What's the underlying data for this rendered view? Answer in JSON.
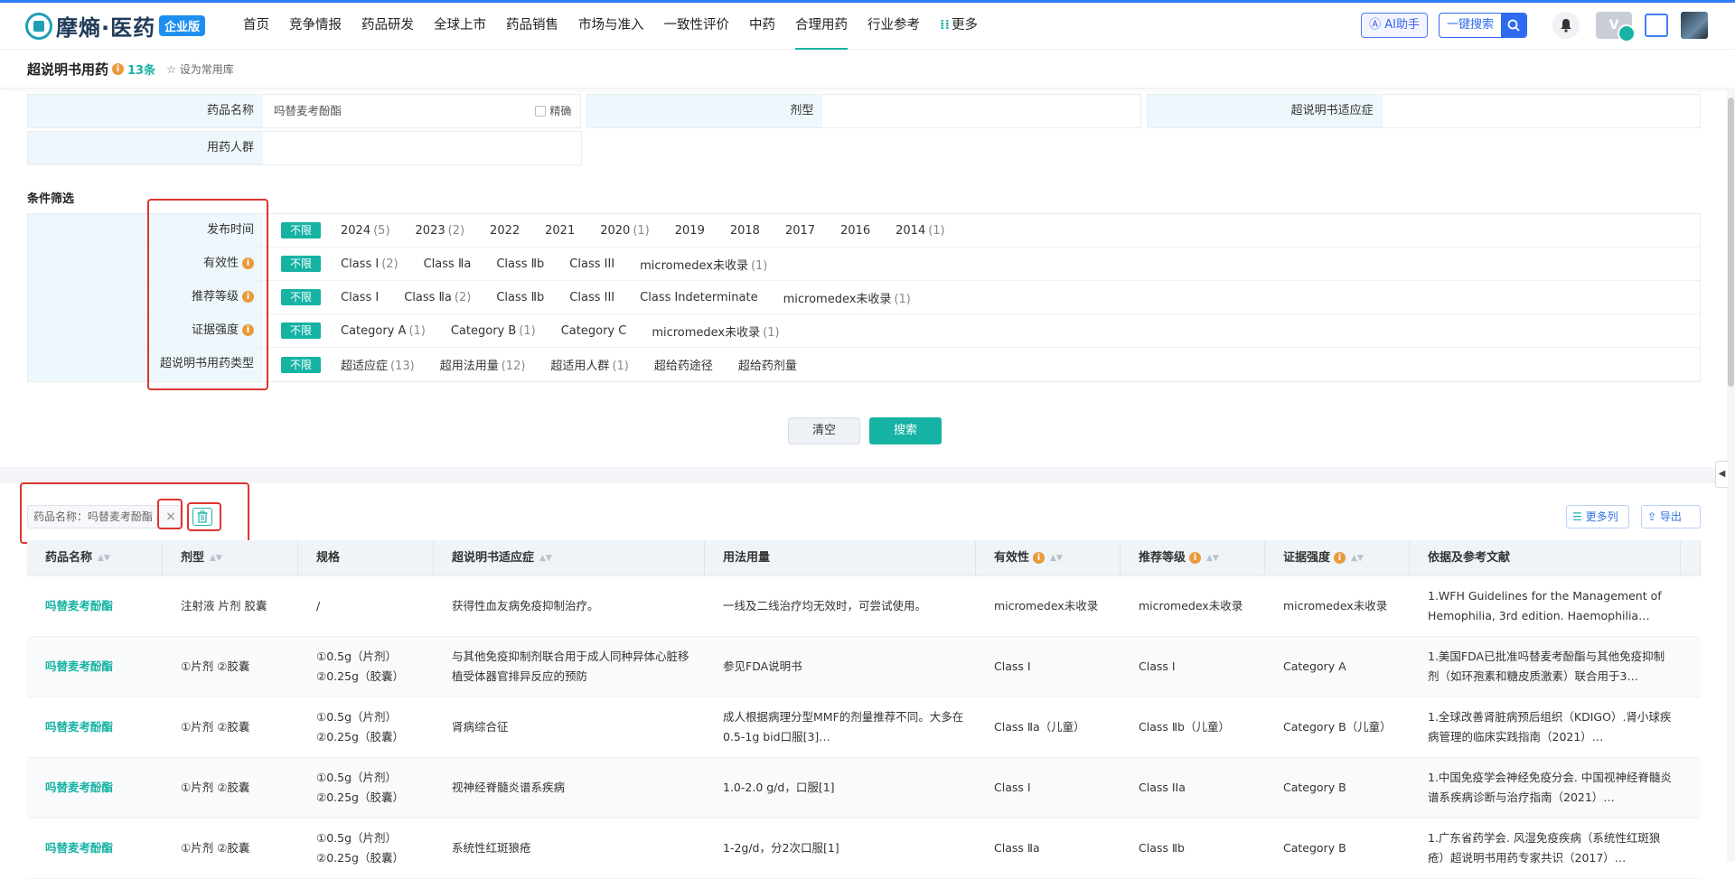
{
  "header": {
    "logo_text": "摩熵·医药",
    "logo_badge": "企业版",
    "nav": [
      "首页",
      "竞争情报",
      "药品研发",
      "全球上市",
      "药品销售",
      "市场与准入",
      "一致性评价",
      "中药",
      "合理用药",
      "行业参考",
      "更多"
    ],
    "active_nav": "合理用药",
    "ai_label": "AI助手",
    "search_label": "一键搜索"
  },
  "subheader": {
    "title": "超说明书用药",
    "count": "13条",
    "fav_label": "设为常用库"
  },
  "form": {
    "drug_label": "药品名称",
    "drug_value": "吗替麦考酚酯",
    "exact_label": "精确",
    "dosage_label": "剂型",
    "indication_label": "超说明书适应症",
    "population_label": "用药人群"
  },
  "filters": {
    "title": "条件筛选",
    "all_label": "不限",
    "rows": [
      {
        "label": "发布时间",
        "info": false,
        "options": [
          {
            "text": "2024",
            "count": "(5)"
          },
          {
            "text": "2023",
            "count": "(2)"
          },
          {
            "text": "2022",
            "count": ""
          },
          {
            "text": "2021",
            "count": ""
          },
          {
            "text": "2020",
            "count": "(1)"
          },
          {
            "text": "2019",
            "count": ""
          },
          {
            "text": "2018",
            "count": ""
          },
          {
            "text": "2017",
            "count": ""
          },
          {
            "text": "2016",
            "count": ""
          },
          {
            "text": "2014",
            "count": "(1)"
          }
        ]
      },
      {
        "label": "有效性",
        "info": true,
        "options": [
          {
            "text": "Class Ⅰ",
            "count": "(2)"
          },
          {
            "text": "Class Ⅱa",
            "count": ""
          },
          {
            "text": "Class Ⅱb",
            "count": ""
          },
          {
            "text": "Class III",
            "count": ""
          },
          {
            "text": "micromedex未收录",
            "count": "(1)"
          }
        ]
      },
      {
        "label": "推荐等级",
        "info": true,
        "options": [
          {
            "text": "Class Ⅰ",
            "count": ""
          },
          {
            "text": "Class Ⅱa",
            "count": "(2)"
          },
          {
            "text": "Class Ⅱb",
            "count": ""
          },
          {
            "text": "Class III",
            "count": ""
          },
          {
            "text": "Class Indeterminate",
            "count": ""
          },
          {
            "text": "micromedex未收录",
            "count": "(1)"
          }
        ]
      },
      {
        "label": "证据强度",
        "info": true,
        "options": [
          {
            "text": "Category A",
            "count": "(1)"
          },
          {
            "text": "Category B",
            "count": "(1)"
          },
          {
            "text": "Category C",
            "count": ""
          },
          {
            "text": "micromedex未收录",
            "count": "(1)"
          }
        ]
      },
      {
        "label": "超说明书用药类型",
        "info": false,
        "options": [
          {
            "text": "超适应症",
            "count": "(13)"
          },
          {
            "text": "超用法用量",
            "count": "(12)"
          },
          {
            "text": "超适用人群",
            "count": "(1)"
          },
          {
            "text": "超给药途径",
            "count": ""
          },
          {
            "text": "超给药剂量",
            "count": ""
          }
        ]
      }
    ]
  },
  "buttons": {
    "clear": "清空",
    "search": "搜索",
    "more_cols": "更多列",
    "export": "导出"
  },
  "result_tag": "药品名称：吗替麦考酚酯",
  "table": {
    "headers": [
      "药品名称",
      "剂型",
      "规格",
      "超说明书适应症",
      "用法用量",
      "有效性",
      "推荐等级",
      "证据强度",
      "依据及参考文献"
    ],
    "rows": [
      [
        "吗替麦考酚酯",
        "注射液 片剂 胶囊",
        "/",
        "获得性血友病免疫抑制治疗。",
        "一线及二线治疗均无效时，可尝试使用。",
        "micromedex未收录",
        "micromedex未收录",
        "micromedex未收录",
        "1.WFH Guidelines for the Management of Hemophilia, 3rd edition. Haemophilia…"
      ],
      [
        "吗替麦考酚酯",
        "①片剂 ②胶囊",
        "①0.5g（片剂）②0.25g（胶囊）",
        "与其他免疫抑制剂联合用于成人同种异体心脏移植受体器官排异反应的预防",
        "参见FDA说明书",
        "Class Ⅰ",
        "Class Ⅰ",
        "Category A",
        "1.美国FDA已批准吗替麦考酚酯与其他免疫抑制剂（如环孢素和糖皮质激素）联合用于3…"
      ],
      [
        "吗替麦考酚酯",
        "①片剂 ②胶囊",
        "①0.5g（片剂）②0.25g（胶囊）",
        "肾病综合征",
        "成人根据病理分型MMF的剂量推荐不同。大多在0.5-1g bid口服[3]…",
        "Class Ⅱa（儿童）",
        "Class Ⅱb（儿童）",
        "Category B（儿童）",
        "1.全球改善肾脏病预后组织（KDIGO）.肾小球疾病管理的临床实践指南（2021）…"
      ],
      [
        "吗替麦考酚酯",
        "①片剂 ②胶囊",
        "①0.5g（片剂）②0.25g（胶囊）",
        "视神经脊髓炎谱系疾病",
        "1.0-2.0 g/d，口服[1]",
        "Class Ⅰ",
        "Class IIa",
        "Category B",
        "1.中国免疫学会神经免疫分会. 中国视神经脊髓炎谱系疾病诊断与治疗指南（2021）…"
      ],
      [
        "吗替麦考酚酯",
        "①片剂 ②胶囊",
        "①0.5g（片剂）②0.25g（胶囊）",
        "系统性红斑狼疮",
        "1-2g/d，分2次口服[1]",
        "Class Ⅱa",
        "Class Ⅱb",
        "Category B",
        "1.广东省药学会. 风湿免疫疾病（系统性红斑狼疮）超说明书用药专家共识（2017）…"
      ]
    ]
  }
}
